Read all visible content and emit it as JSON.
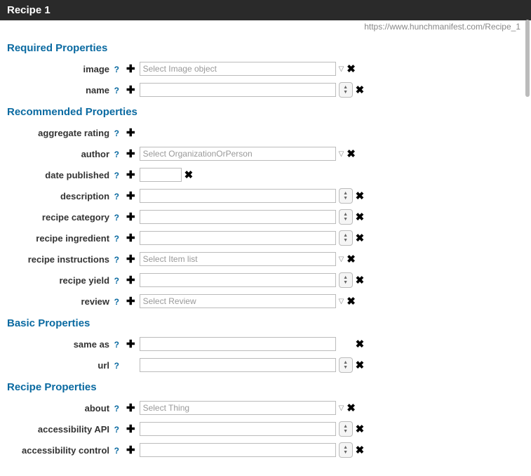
{
  "header": {
    "title": "Recipe 1"
  },
  "url": "https://www.hunchmanifest.com/Recipe_1",
  "sections": {
    "required": {
      "title": "Required Properties",
      "image": {
        "label": "image",
        "placeholder": "Select Image object"
      },
      "name_field": {
        "label": "name"
      }
    },
    "recommended": {
      "title": "Recommended Properties",
      "aggregate_rating": {
        "label": "aggregate rating"
      },
      "author": {
        "label": "author",
        "placeholder": "Select OrganizationOrPerson"
      },
      "date_published": {
        "label": "date published"
      },
      "description": {
        "label": "description"
      },
      "recipe_category": {
        "label": "recipe category"
      },
      "recipe_ingredient": {
        "label": "recipe ingredient"
      },
      "recipe_instructions": {
        "label": "recipe instructions",
        "placeholder": "Select Item list"
      },
      "recipe_yield": {
        "label": "recipe yield"
      },
      "review": {
        "label": "review",
        "placeholder": "Select Review"
      }
    },
    "basic": {
      "title": "Basic Properties",
      "same_as": {
        "label": "same as"
      },
      "url_field": {
        "label": "url"
      }
    },
    "recipe": {
      "title": "Recipe Properties",
      "about": {
        "label": "about",
        "placeholder": "Select Thing"
      },
      "accessibility_api": {
        "label": "accessibility API"
      },
      "accessibility_control": {
        "label": "accessibility control"
      }
    }
  }
}
